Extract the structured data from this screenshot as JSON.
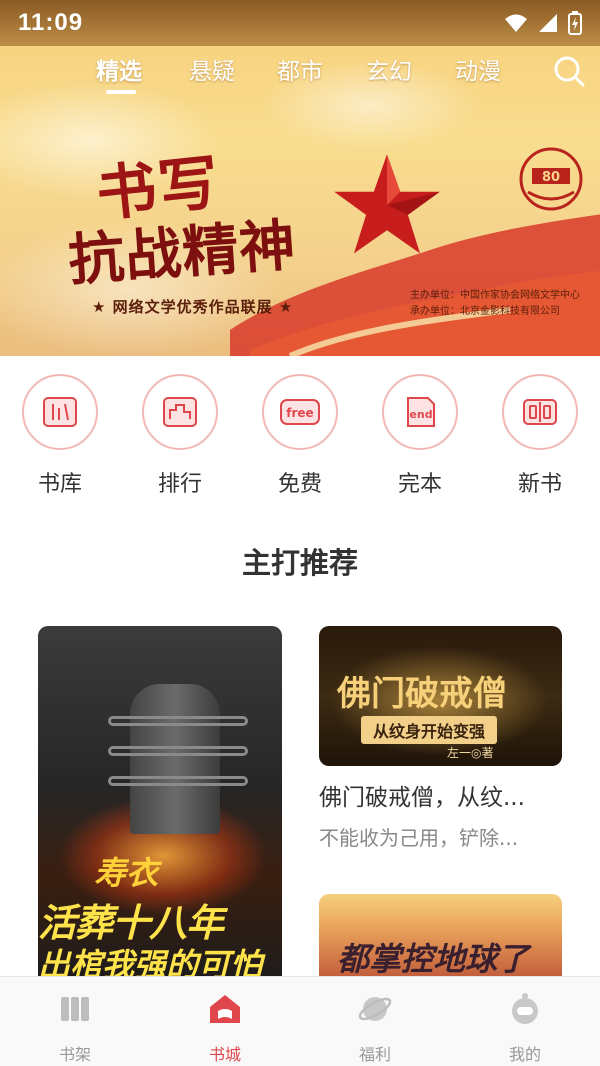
{
  "status_bar": {
    "time": "11:09"
  },
  "top_tabs": [
    {
      "label": "精选",
      "active": true
    },
    {
      "label": "悬疑",
      "active": false
    },
    {
      "label": "都市",
      "active": false
    },
    {
      "label": "玄幻",
      "active": false
    },
    {
      "label": "动漫",
      "active": false
    }
  ],
  "banner": {
    "title_line1": "书写",
    "title_line2": "抗战精神",
    "subtitle": "★ 网络文学优秀作品联展 ★",
    "organizer": "主办单位：中国作家协会网络文学中心",
    "co_organizer": "承办单位：北京金影科技有限公司",
    "badge_number": "80"
  },
  "categories": [
    {
      "label": "书库",
      "icon": "library-icon"
    },
    {
      "label": "排行",
      "icon": "ranking-icon"
    },
    {
      "label": "免费",
      "icon": "free-icon",
      "icon_text": "free"
    },
    {
      "label": "完本",
      "icon": "finished-icon",
      "icon_text": "end"
    },
    {
      "label": "新书",
      "icon": "new-book-icon"
    }
  ],
  "section": {
    "title": "主打推荐"
  },
  "books": {
    "featured_cover": {
      "line1": "寿衣",
      "line2": "活葬十八年",
      "line3": "出棺我强的可怕"
    },
    "second": {
      "cover_title": "佛门破戒僧",
      "cover_subtitle": "从纹身开始变强",
      "cover_author": "左一◎著",
      "title": "佛门破戒僧，从纹...",
      "description": "不能收为己用，铲除..."
    },
    "third": {
      "cover_title": "都掌控地球了"
    }
  },
  "bottom_nav": [
    {
      "label": "书架",
      "icon": "bookshelf-icon",
      "active": false
    },
    {
      "label": "书城",
      "icon": "bookstore-icon",
      "active": true
    },
    {
      "label": "福利",
      "icon": "planet-icon",
      "active": false
    },
    {
      "label": "我的",
      "icon": "profile-icon",
      "active": false
    }
  ],
  "colors": {
    "accent": "#e0474c",
    "icon_ring": "#f1b7b7",
    "inactive": "#999999"
  }
}
